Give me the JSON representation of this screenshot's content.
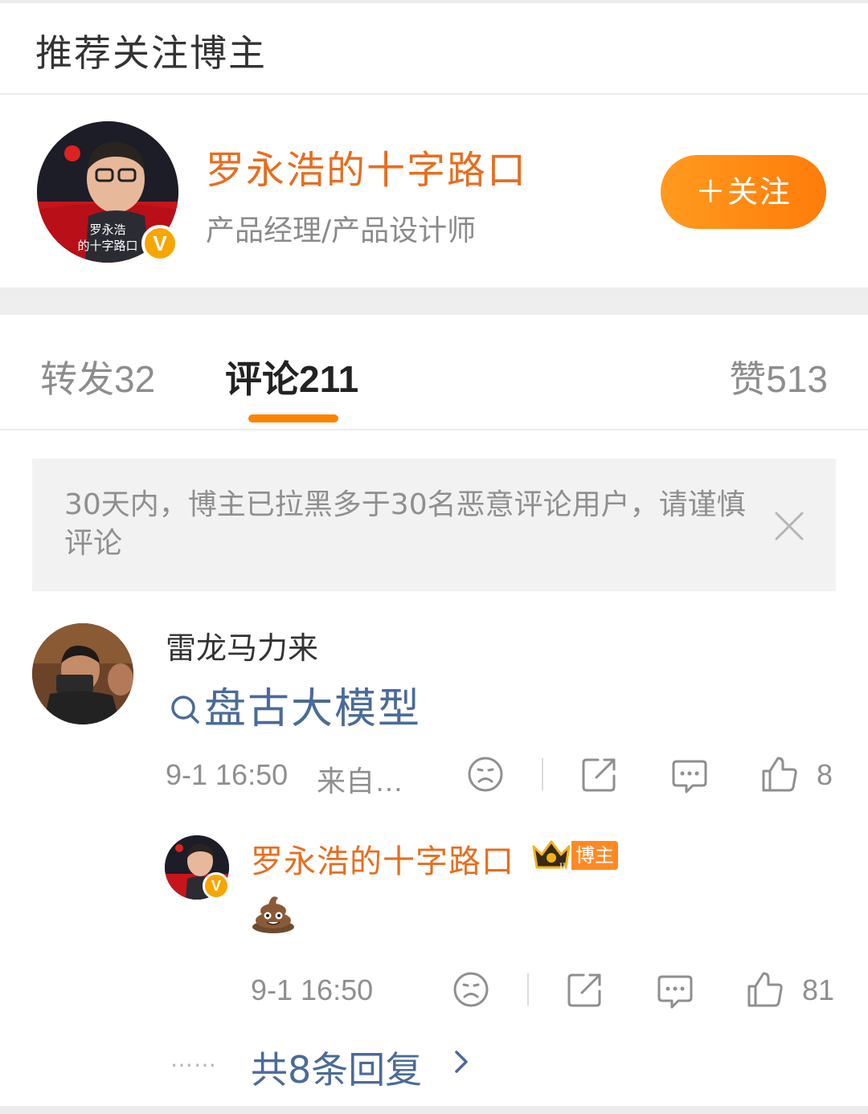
{
  "section": {
    "title": "推荐关注博主"
  },
  "recommend": {
    "name": "罗永浩的十字路口",
    "description": "产品经理/产品设计师",
    "follow_label": "＋关注",
    "avatar_caption_1": "罗永浩",
    "avatar_caption_2": "的十字路口",
    "verify_mark": "V"
  },
  "tabs": {
    "repost": "转发32",
    "comment": "评论211",
    "like": "赞513"
  },
  "notice": {
    "text": "30天内，博主已拉黑多于30名恶意评论用户，请谨慎评论"
  },
  "comment": {
    "user": "雷龙马力来",
    "topic": "盘古大模型",
    "time": "9-1 16:50",
    "source": "来自…",
    "like_count": "8"
  },
  "reply": {
    "user": "罗永浩的十字路口",
    "tag": "博主",
    "crown_level": "II",
    "content": "💩",
    "time": "9-1 16:50",
    "like_count": "81"
  },
  "more": {
    "dots": "……",
    "label": "共8条回复"
  },
  "colors": {
    "accent": "#ff8200",
    "name_orange": "#e86d1f",
    "link_blue": "#4b6b98",
    "muted": "#8f8f8f"
  },
  "icons": [
    "close-icon",
    "search-icon",
    "sad-face-icon",
    "share-icon",
    "comment-icon",
    "thumbs-up-icon",
    "chevron-right-icon",
    "crown-icon",
    "verified-icon"
  ]
}
